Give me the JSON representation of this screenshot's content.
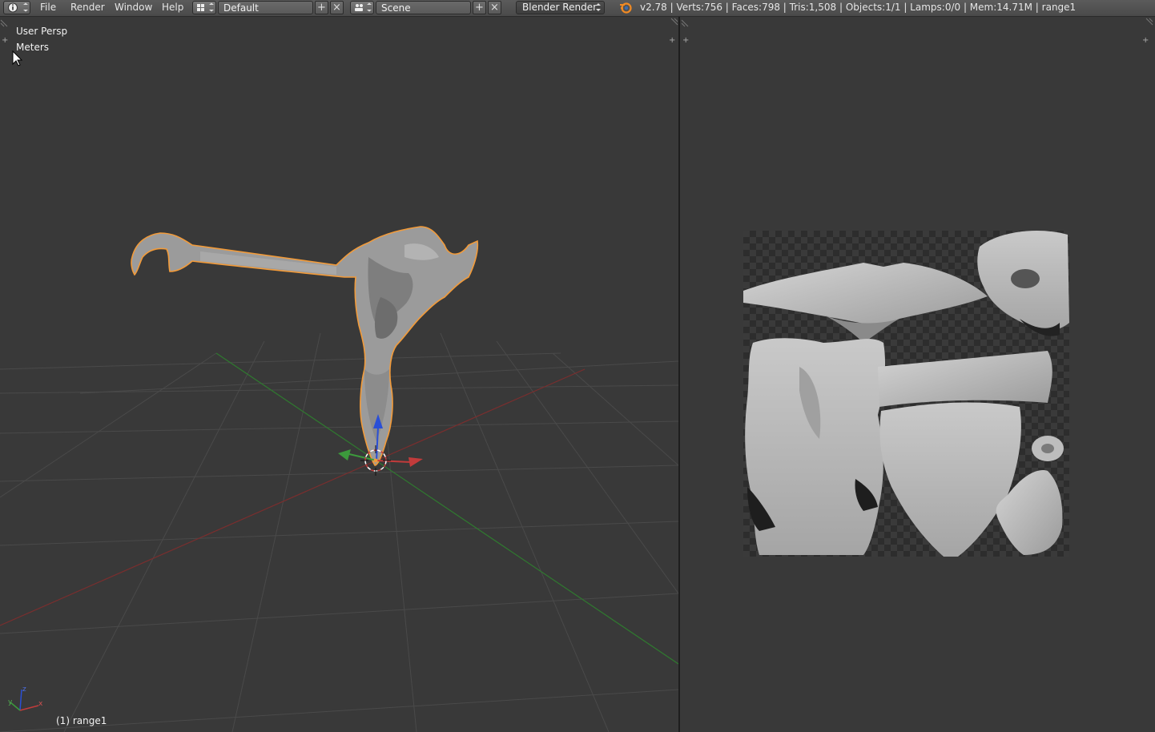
{
  "header": {
    "editor_type_icon": "info-icon",
    "menus": [
      "File",
      "Render",
      "Window",
      "Help"
    ],
    "screen_layout_icon": "layout-icon",
    "screen_layout": "Default",
    "scene_icon": "scene-icon",
    "scene": "Scene",
    "render_engine": "Blender Render",
    "blender_logo_icon": "blender-logo-icon",
    "stats": "v2.78 | Verts:756 | Faces:798 | Tris:1,508 | Objects:1/1 | Lamps:0/0 | Mem:14.71M | range1"
  },
  "viewport3d": {
    "view_name": "User Persp",
    "units": "Meters",
    "object_label": "(1) range1",
    "axis_labels": {
      "z": "z",
      "x": "x",
      "y": "y"
    },
    "colors": {
      "x_axis": "#c23b3b",
      "y_axis": "#3c9a3c",
      "z_axis": "#2a4fd6",
      "selection_outline": "#f29b3a"
    }
  },
  "uv_editor": {
    "image_panel": "uv-texture-image"
  }
}
